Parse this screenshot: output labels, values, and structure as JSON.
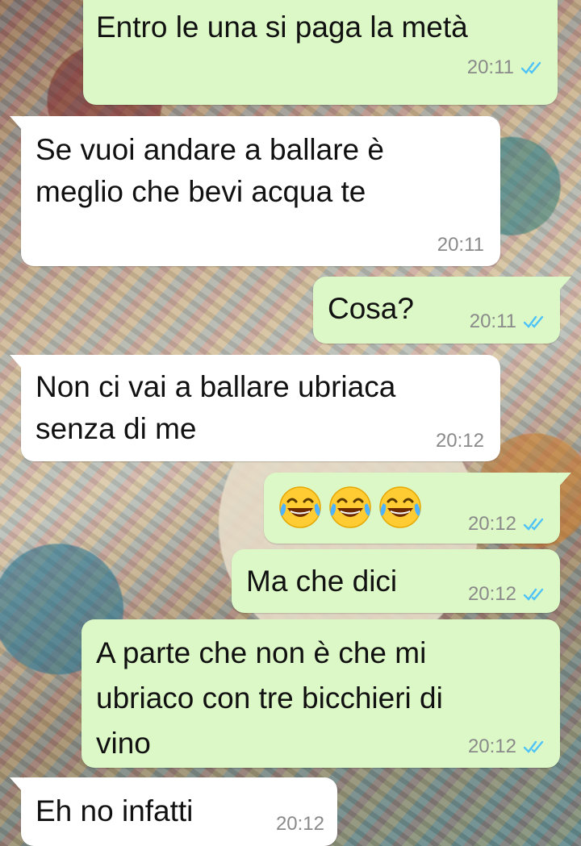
{
  "chat": {
    "messages": [
      {
        "direction": "out",
        "text": "Entro le una si paga la metà",
        "time": "20:11",
        "status": "read"
      },
      {
        "direction": "in",
        "text": "Se vuoi andare a ballare è\nmeglio che bevi acqua te",
        "time": "20:11"
      },
      {
        "direction": "out",
        "text": "Cosa?",
        "time": "20:11",
        "status": "read"
      },
      {
        "direction": "in",
        "text": "Non ci vai a ballare ubriaca\nsenza di me",
        "time": "20:12"
      },
      {
        "direction": "out",
        "emoji": [
          "face-with-tears-of-joy",
          "face-with-tears-of-joy",
          "face-with-tears-of-joy"
        ],
        "time": "20:12",
        "status": "read"
      },
      {
        "direction": "out",
        "text": "Ma che dici",
        "time": "20:12",
        "status": "read"
      },
      {
        "direction": "out",
        "text": "A parte che non è che mi\nubriaco con tre bicchieri di\nvino",
        "time": "20:12",
        "status": "read"
      },
      {
        "direction": "in",
        "text": "Eh no infatti",
        "time": "20:12"
      }
    ]
  },
  "colors": {
    "outgoing_bubble": "#dcf8c6",
    "incoming_bubble": "#ffffff",
    "read_tick": "#4fc3f7",
    "timestamp": "#8a8a8a"
  },
  "icons": {
    "read_receipt": "double-check-icon",
    "emoji": "face-with-tears-of-joy-icon"
  }
}
